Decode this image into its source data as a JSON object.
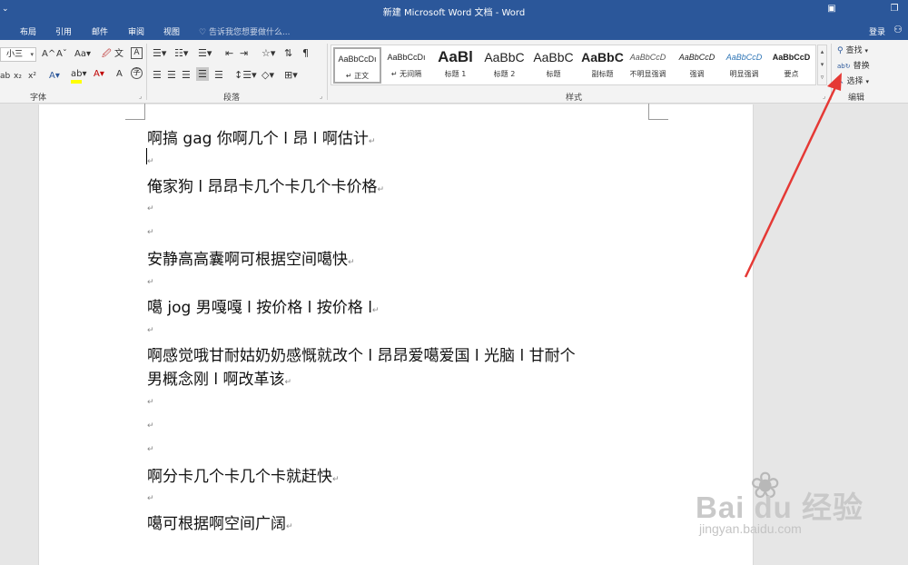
{
  "window": {
    "title": "新建 Microsoft Word 文档 - Word",
    "restore_icon": "restore-icon",
    "maximize_icon": "maximize-icon"
  },
  "tabs": [
    "布局",
    "引用",
    "邮件",
    "审阅",
    "视图"
  ],
  "tell_me": "告诉我您想要做什么...",
  "login": "登录",
  "ribbon": {
    "font_size": "小三",
    "groups": {
      "font": "字体",
      "paragraph": "段落",
      "styles": "样式",
      "editing": "编辑"
    },
    "styles": [
      {
        "sample": "AaBbCcDı",
        "name": "↵ 正文",
        "selected": true
      },
      {
        "sample": "AaBbCcDı",
        "name": "↵ 无间隔",
        "selected": false
      },
      {
        "sample": "AaBl",
        "name": "标题 1",
        "selected": false
      },
      {
        "sample": "AaBbC",
        "name": "标题 2",
        "selected": false
      },
      {
        "sample": "AaBbC",
        "name": "标题",
        "selected": false
      },
      {
        "sample": "AaBbC",
        "name": "副标题",
        "selected": false
      },
      {
        "sample": "AaBbCcD",
        "name": "不明显强调",
        "selected": false
      },
      {
        "sample": "AaBbCcD",
        "name": "强调",
        "selected": false
      },
      {
        "sample": "AaBbCcD",
        "name": "明显强调",
        "selected": false
      },
      {
        "sample": "AaBbCcD",
        "name": "要点",
        "selected": false
      }
    ],
    "editing": {
      "find": "查找",
      "replace": "替换",
      "select": "选择"
    }
  },
  "document": {
    "lines": {
      "l1": "啊搞 gag 你啊几个 l 昂 l 啊估计",
      "l2": "俺家狗 l 昂昂卡几个卡几个卡价格",
      "l3": "安静高高囊啊可根据空间噶快",
      "l4": "噶 jog 男嘎嘎 l 按价格 l 按价格 l",
      "l5a": "啊感觉哦甘耐姑奶奶感慨就改个 l 昂昂爱噶爱国 l 光脑 l 甘耐个",
      "l5b": "男概念刚 l 啊改革该",
      "l6": "啊分卡几个卡几个卡就赶快",
      "l7": "噶可根据啊空间广阔"
    },
    "paragraph_mark": "↵"
  },
  "watermark": {
    "brand": "Bai du 经验",
    "url": "jingyan.baidu.com"
  },
  "colors": {
    "titlebar": "#2b579a",
    "ribbon": "#f3f3f3",
    "arrow": "#e53935"
  }
}
